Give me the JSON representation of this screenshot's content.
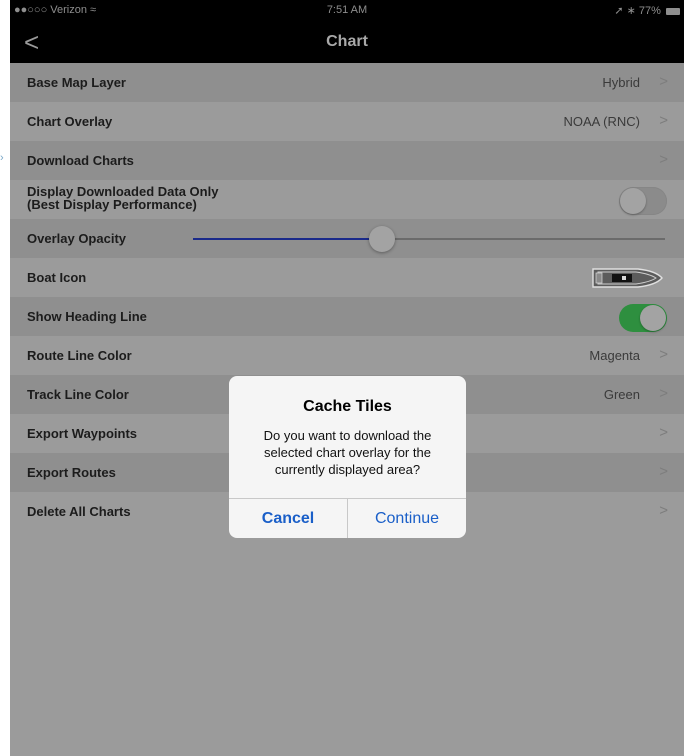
{
  "status_bar": {
    "carrier": "●●○○○ Verizon",
    "wifi_icon": "wifi-icon",
    "time": "7:51 AM",
    "battery": "77%"
  },
  "nav": {
    "back_glyph": "<",
    "title": "Chart"
  },
  "settings": {
    "base_map_layer": {
      "label": "Base Map Layer",
      "value": "Hybrid"
    },
    "chart_overlay": {
      "label": "Chart Overlay",
      "value": "NOAA (RNC)"
    },
    "download_charts": {
      "label": "Download Charts"
    },
    "display_downloaded": {
      "label_line1": "Display Downloaded Data Only",
      "label_line2": "(Best Display Performance)",
      "enabled": false
    },
    "overlay_opacity": {
      "label": "Overlay Opacity",
      "level_percent": 40
    },
    "boat_icon": {
      "label": "Boat Icon"
    },
    "show_heading_line": {
      "label": "Show Heading Line",
      "enabled": true
    },
    "route_line_color": {
      "label": "Route Line Color",
      "value": "Magenta"
    },
    "track_line_color": {
      "label": "Track Line Color",
      "value": "Green"
    },
    "export_waypoints": {
      "label": "Export Waypoints"
    },
    "export_routes": {
      "label": "Export Routes"
    },
    "delete_all_charts": {
      "label": "Delete All Charts"
    }
  },
  "chevron_glyph": ">",
  "dialog": {
    "title": "Cache Tiles",
    "message": "Do you want to download the selected chart overlay for the currently displayed area?",
    "cancel_label": "Cancel",
    "continue_label": "Continue"
  },
  "colors": {
    "toggle_on": "#2e8f3f",
    "slider_fill": "#1a2a8a",
    "dialog_button": "#1a5fc8"
  }
}
